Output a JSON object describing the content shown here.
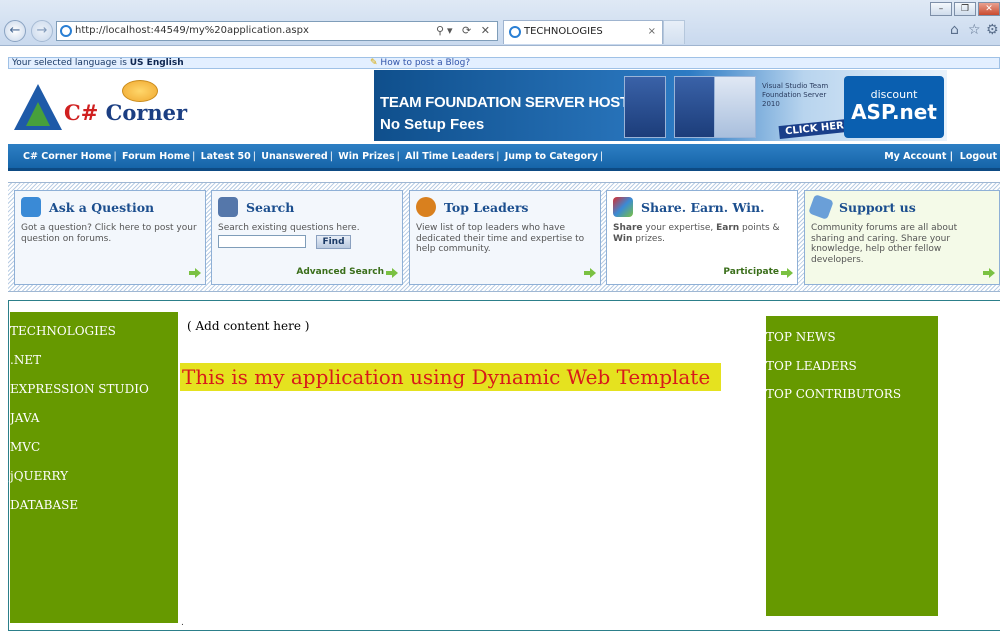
{
  "browser": {
    "url": "http://localhost:44549/my%20application.aspx",
    "tab_title": "TECHNOLOGIES",
    "tab_close": "×"
  },
  "langbar": {
    "prefix": "Your selected language is ",
    "language": "US English",
    "blog_link": "How to post a Blog?"
  },
  "logo": {
    "text_cs": "C#",
    "text_corner": " Corner"
  },
  "banner": {
    "line1": "TEAM FOUNDATION SERVER HOSTING",
    "line2": "No Setup Fees",
    "vs_text": "Visual Studio Team Foundation Server 2010",
    "click": "CLICK HERE",
    "brand_small": "discount",
    "brand_big": "ASP.net"
  },
  "navbar": {
    "links": [
      "C# Corner Home",
      "Forum Home",
      "Latest 50",
      "Unanswered",
      "Win Prizes",
      "All Time Leaders",
      "Jump to Category"
    ],
    "account": "My Account",
    "logout": "Logout"
  },
  "cards": {
    "ask": {
      "title": "Ask a Question",
      "desc": "Got a question? Click here to post your question on forums."
    },
    "search": {
      "title": "Search",
      "desc": "Search existing questions here.",
      "button": "Find",
      "advanced": "Advanced Search"
    },
    "leaders": {
      "title": "Top Leaders",
      "desc": "View list of top leaders who have dedicated their time and expertise to help community."
    },
    "share": {
      "title": "Share. Earn. Win.",
      "desc_share": "Share",
      "desc_mid1": " your expertise, ",
      "desc_earn": "Earn",
      "desc_mid2": " points & ",
      "desc_win": "Win",
      "desc_end": " prizes.",
      "participate": "Participate"
    },
    "support": {
      "title": "Support us",
      "desc": "Community forums are all about sharing and caring. Share your knowledge, help other fellow developers."
    }
  },
  "left_nav": [
    "TECHNOLOGIES",
    ".NET",
    "EXPRESSION STUDIO",
    "JAVA",
    "MVC",
    "jQUERRY",
    "DATABASE"
  ],
  "right_nav": [
    "TOP NEWS",
    "TOP LEADERS",
    "TOP CONTRIBUTORS"
  ],
  "main": {
    "add_content": "( Add content here )",
    "headline": "This is my application using Dynamic Web Template"
  },
  "colors": {
    "sidebar": "#669900",
    "headline_bg": "#e5e21f",
    "headline_text": "#d81a1a",
    "navbar": "#1664a8"
  }
}
